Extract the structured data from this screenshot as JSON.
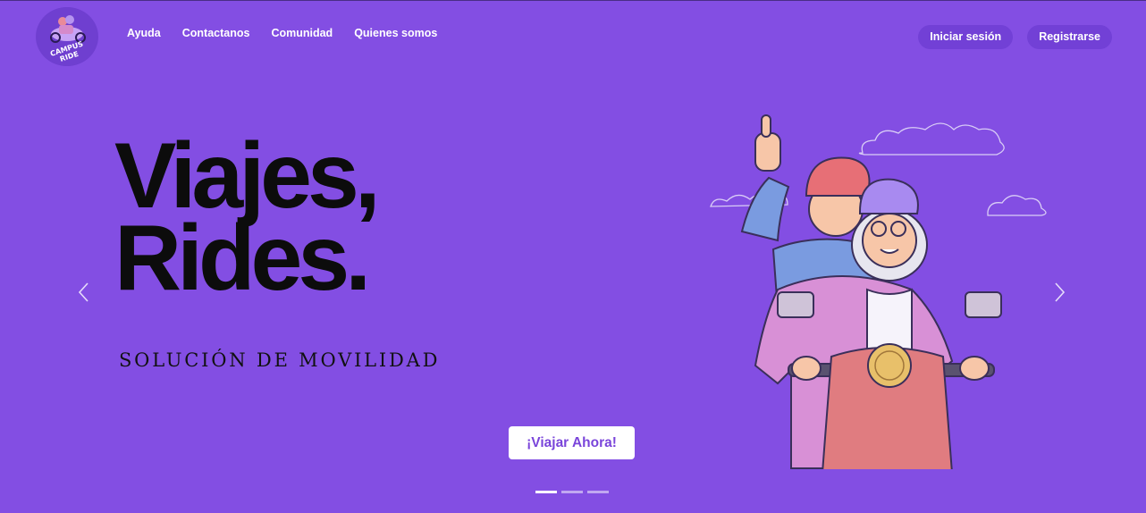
{
  "brand": {
    "logo_text": "CAMPUS RIDE"
  },
  "nav": {
    "items": [
      "Ayuda",
      "Contactanos",
      "Comunidad",
      "Quienes somos"
    ]
  },
  "auth": {
    "login_label": "Iniciar sesión",
    "register_label": "Registrarse"
  },
  "hero": {
    "headline_line1": "Viajes,",
    "headline_line2": "Rides.",
    "tagline": "SOLUCIÓN DE MOVILIDAD",
    "cta_label": "¡Viajar Ahora!"
  },
  "carousel": {
    "slides_total": 3,
    "active_slide": 1
  },
  "colors": {
    "background": "#834ee3",
    "button_bg": "#7240d6",
    "cta_text": "#7a45da"
  },
  "icons": {
    "prev": "chevron-left-icon",
    "next": "chevron-right-icon"
  }
}
